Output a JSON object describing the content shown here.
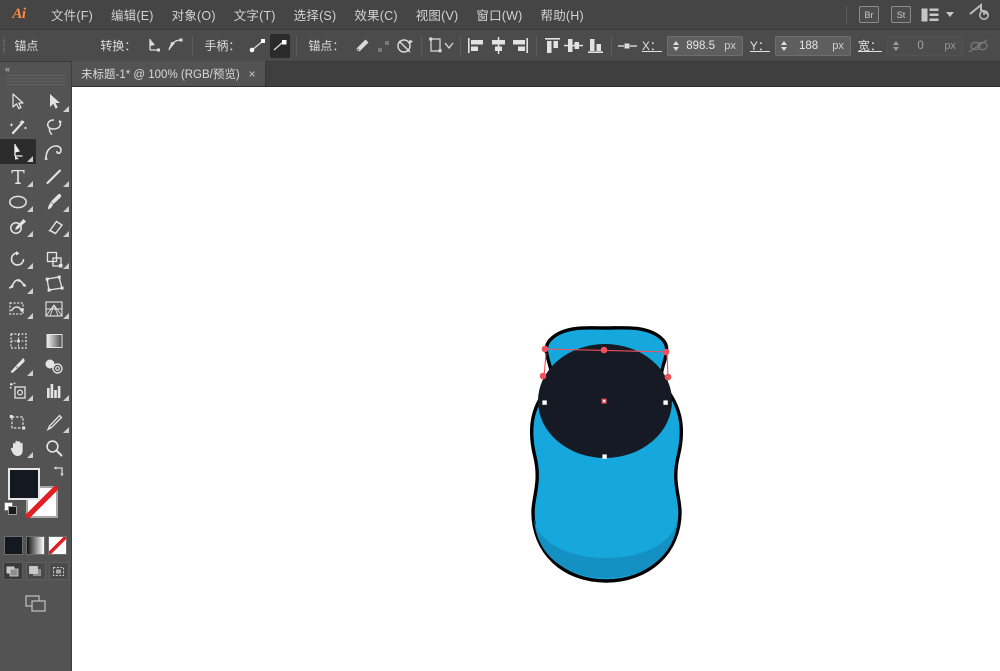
{
  "app": {
    "name": "Adobe Illustrator",
    "logo_text": "Ai",
    "accent_color": "#ff8a3d",
    "chrome_color": "#454545"
  },
  "menubar": {
    "items": [
      {
        "label": "文件(F)",
        "name": "menu-file"
      },
      {
        "label": "编辑(E)",
        "name": "menu-edit"
      },
      {
        "label": "对象(O)",
        "name": "menu-object"
      },
      {
        "label": "文字(T)",
        "name": "menu-type"
      },
      {
        "label": "选择(S)",
        "name": "menu-select"
      },
      {
        "label": "效果(C)",
        "name": "menu-effect"
      },
      {
        "label": "视图(V)",
        "name": "menu-view"
      },
      {
        "label": "窗口(W)",
        "name": "menu-window"
      },
      {
        "label": "帮助(H)",
        "name": "menu-help"
      }
    ],
    "right": {
      "bridge_label": "Br",
      "stock_label": "St",
      "workspace_icon": "layout-icon",
      "cc_icon": "creative-cloud-icon"
    }
  },
  "controlbar": {
    "selection_label": "锚点",
    "convert_label": "转换：",
    "handles_label": "手柄：",
    "anchor_label": "锚点：",
    "x_label": "X：",
    "x_value": "898.5",
    "x_unit": "px",
    "y_label": "Y：",
    "y_value": "188",
    "y_unit": "px",
    "w_label": "宽：",
    "w_value": "0",
    "w_unit": "px",
    "icons": {
      "convert_corner": "convert-to-corner-icon",
      "convert_smooth": "convert-to-smooth-icon",
      "handle_show": "show-handles-icon",
      "handle_hide": "hide-handles-icon",
      "anchor_pen": "anchor-pen-icon",
      "isolate": "isolate-selection-icon",
      "mask": "make-mask-icon",
      "transform": "transform-panel-icon",
      "align_left": "align-left-icon",
      "align_center_h": "align-center-horizontal-icon",
      "align_right": "align-right-icon",
      "align_top": "align-top-icon",
      "align_center_v": "align-center-vertical-icon",
      "align_bottom": "align-bottom-icon",
      "reference_point": "reference-point-icon",
      "link_dimensions": "link-dimensions-icon"
    }
  },
  "tabbar": {
    "tabs": [
      {
        "title": "未标题-1* @ 100% (RGB/预览)",
        "close": "×",
        "active": true
      }
    ]
  },
  "toolpanel": {
    "collapse_icon": "collapse-panel-chevron-icon",
    "tools": [
      {
        "name": "selection-tool",
        "label": "选择工具",
        "icon": "arrow-outline-icon",
        "active": false,
        "corner": false
      },
      {
        "name": "direct-selection-tool",
        "label": "直接选择工具",
        "icon": "arrow-solid-icon",
        "active": false,
        "corner": true
      },
      {
        "name": "magic-wand-tool",
        "label": "魔棒工具",
        "icon": "magic-wand-icon",
        "active": false,
        "corner": false
      },
      {
        "name": "lasso-tool",
        "label": "套索工具",
        "icon": "lasso-icon",
        "active": false,
        "corner": false
      },
      {
        "name": "pen-tool",
        "label": "钢笔工具",
        "icon": "pen-icon",
        "active": true,
        "corner": true
      },
      {
        "name": "curvature-tool",
        "label": "曲率工具",
        "icon": "curvature-icon",
        "active": false,
        "corner": false
      },
      {
        "name": "type-tool",
        "label": "文字工具",
        "icon": "type-t-icon",
        "active": false,
        "corner": true
      },
      {
        "name": "line-segment-tool",
        "label": "直线段工具",
        "icon": "line-segment-icon",
        "active": false,
        "corner": true
      },
      {
        "name": "ellipse-tool",
        "label": "椭圆工具",
        "icon": "ellipse-icon",
        "active": false,
        "corner": true
      },
      {
        "name": "paintbrush-tool",
        "label": "画笔工具",
        "icon": "paintbrush-icon",
        "active": false,
        "corner": true
      },
      {
        "name": "shaper-tool",
        "label": "Shaper 工具",
        "icon": "pencil-icon",
        "active": false,
        "corner": true
      },
      {
        "name": "eraser-tool",
        "label": "橡皮擦工具",
        "icon": "eraser-icon",
        "active": false,
        "corner": true
      },
      {
        "name": "rotate-tool",
        "label": "旋转工具",
        "icon": "rotate-icon",
        "active": false,
        "corner": true
      },
      {
        "name": "scale-tool",
        "label": "比例缩放工具",
        "icon": "scale-icon",
        "active": false,
        "corner": true
      },
      {
        "name": "width-tool",
        "label": "宽度工具",
        "icon": "width-warp-icon",
        "active": false,
        "corner": true
      },
      {
        "name": "free-transform-tool",
        "label": "自由变换工具",
        "icon": "free-transform-icon",
        "active": false,
        "corner": false
      },
      {
        "name": "shape-builder-tool",
        "label": "形状生成器工具",
        "icon": "shape-builder-icon",
        "active": false,
        "corner": true
      },
      {
        "name": "perspective-grid-tool",
        "label": "透视网格工具",
        "icon": "perspective-grid-icon",
        "active": false,
        "corner": true
      },
      {
        "name": "mesh-tool",
        "label": "网格工具",
        "icon": "mesh-icon",
        "active": false,
        "corner": false
      },
      {
        "name": "gradient-tool",
        "label": "渐变工具",
        "icon": "gradient-icon",
        "active": false,
        "corner": false
      },
      {
        "name": "eyedropper-tool",
        "label": "吸管工具",
        "icon": "eyedropper-icon",
        "active": false,
        "corner": true
      },
      {
        "name": "blend-tool",
        "label": "混合工具",
        "icon": "blend-icon",
        "active": false,
        "corner": false
      },
      {
        "name": "symbol-sprayer-tool",
        "label": "符号喷枪工具",
        "icon": "symbol-sprayer-icon",
        "active": false,
        "corner": true
      },
      {
        "name": "column-graph-tool",
        "label": "柱形图工具",
        "icon": "column-graph-icon",
        "active": false,
        "corner": true
      },
      {
        "name": "artboard-tool",
        "label": "画板工具",
        "icon": "artboard-icon",
        "active": false,
        "corner": false
      },
      {
        "name": "slice-tool",
        "label": "切片工具",
        "icon": "slice-knife-icon",
        "active": false,
        "corner": true
      },
      {
        "name": "hand-tool",
        "label": "抓手工具",
        "icon": "hand-icon",
        "active": false,
        "corner": true
      },
      {
        "name": "zoom-tool",
        "label": "缩放工具",
        "icon": "magnifier-icon",
        "active": false,
        "corner": false
      }
    ],
    "fill": {
      "name": "fill-swatch",
      "color": "#141821"
    },
    "stroke": {
      "name": "stroke-swatch",
      "color": "none"
    },
    "swap_icon": "swap-fill-stroke-icon",
    "default_icon": "default-fill-stroke-icon",
    "modes": [
      {
        "name": "color-mode-button",
        "icon": "color-icon"
      },
      {
        "name": "gradient-mode-button",
        "icon": "gradient-icon"
      },
      {
        "name": "none-mode-button",
        "icon": "none-slash-icon"
      }
    ],
    "draw_modes": [
      {
        "name": "draw-normal-button",
        "icon": "draw-normal-icon",
        "active": true
      },
      {
        "name": "draw-behind-button",
        "icon": "draw-behind-icon",
        "active": false
      },
      {
        "name": "draw-inside-button",
        "icon": "draw-inside-icon",
        "active": false
      }
    ],
    "screen_mode": {
      "name": "change-screen-mode-button",
      "icon": "screen-mode-icon"
    }
  },
  "canvas": {
    "background": "#ffffff",
    "zoom": "100%",
    "artwork": {
      "name": "blue-blob-with-dark-ellipse",
      "body_color": "#16a8dd",
      "body_shadow_color": "#1491c2",
      "head_color": "#151a24",
      "outline_color": "#000000",
      "anchor_color": "#f2505a",
      "anchor_point_color": "#ffffff",
      "center_mark_color": "#f2505a"
    }
  }
}
